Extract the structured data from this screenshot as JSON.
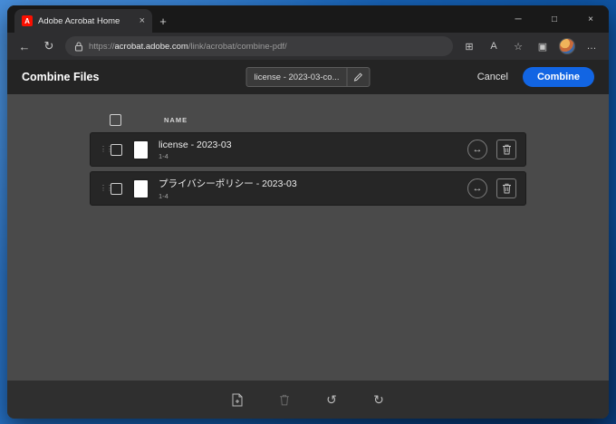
{
  "colors": {
    "accent": "#1265e3",
    "adobe_red": "#fa0f00"
  },
  "icons": {
    "favicon_letter": "A",
    "tab_close": "×",
    "new_tab": "+",
    "minimize": "─",
    "maximize": "□",
    "close": "×",
    "back": "←",
    "refresh": "↻",
    "split_screen": "⊞",
    "read_aloud": "A",
    "favorite": "☆",
    "collections": "▣",
    "more": "…",
    "drag_handle": "⋮⋮",
    "expand": "↔",
    "undo": "↺",
    "redo": "↻"
  },
  "titlebar": {
    "tab_title": "Adobe Acrobat Home"
  },
  "address_bar": {
    "url_scheme": "https://",
    "url_domain": "acrobat.adobe.com",
    "url_path": "/link/acrobat/combine-pdf/"
  },
  "header": {
    "title": "Combine Files",
    "filename": "license - 2023-03-co...",
    "cancel": "Cancel",
    "combine": "Combine"
  },
  "table": {
    "name_header": "NAME",
    "rows": [
      {
        "name": "license - 2023-03",
        "pages": "1-4"
      },
      {
        "name": "プライバシーポリシー - 2023-03",
        "pages": "1-4"
      }
    ]
  }
}
